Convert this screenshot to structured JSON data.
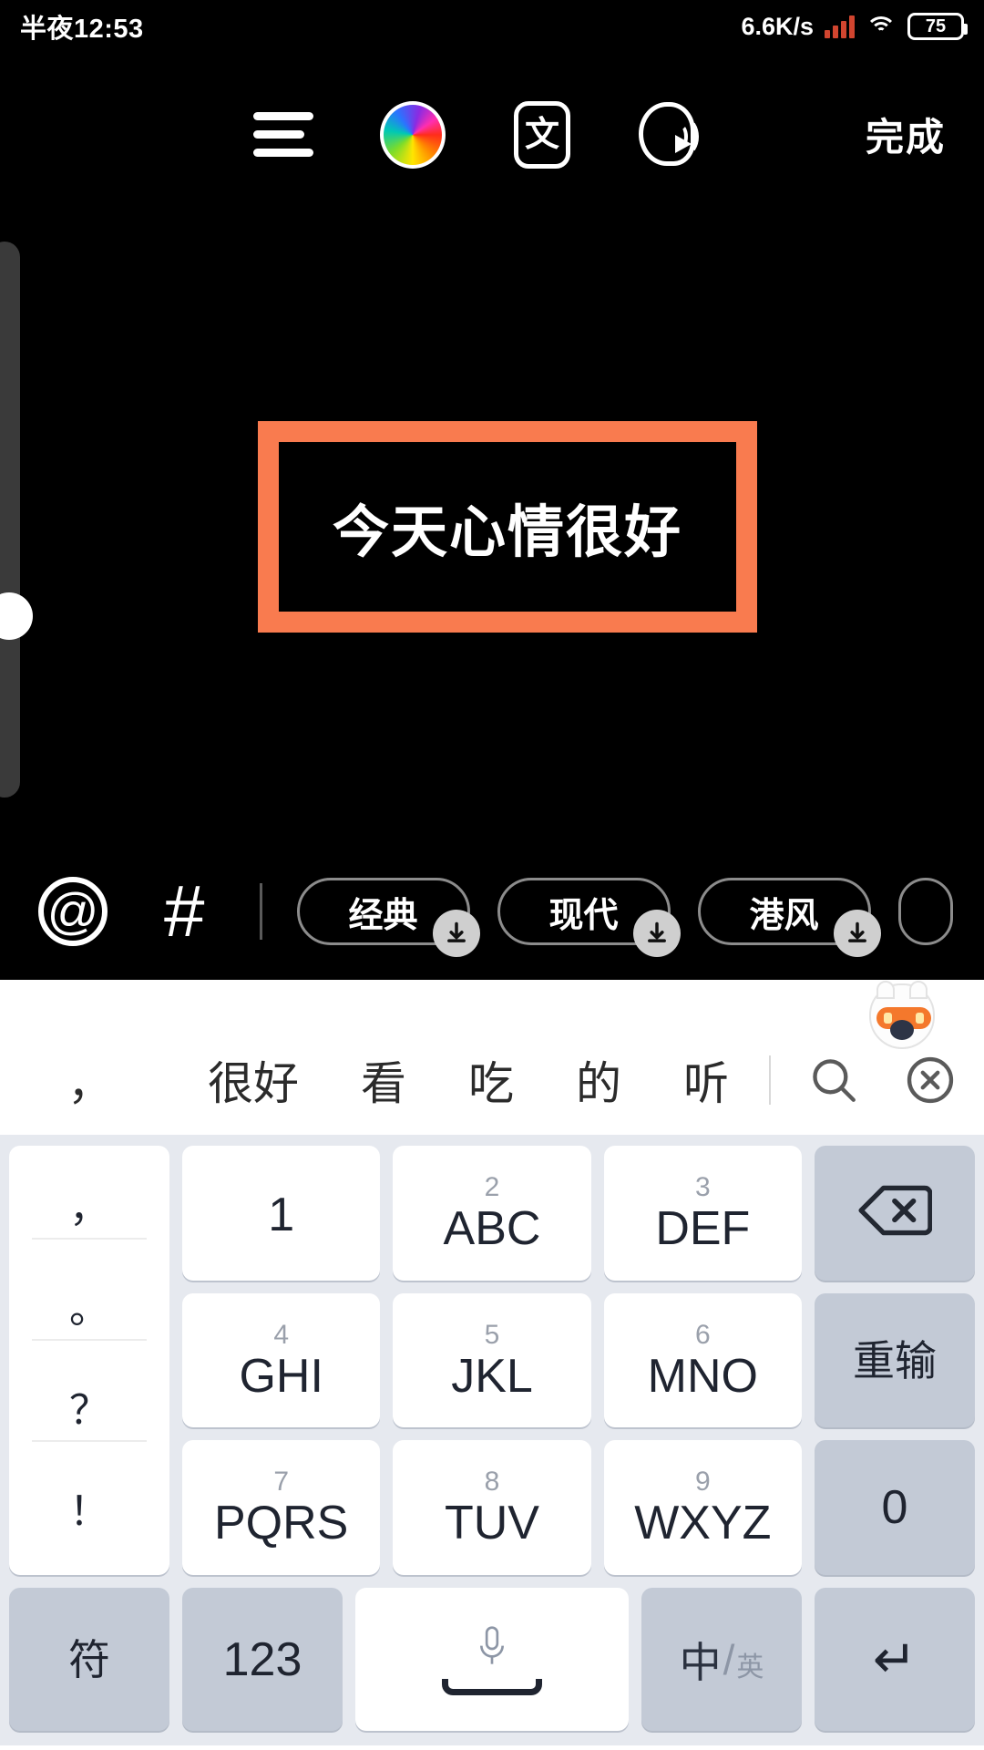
{
  "status_bar": {
    "time": "半夜12:53",
    "net_speed": "6.6K/s",
    "battery_level": "75",
    "signal_icon": "cellular-signal-icon",
    "wifi_icon": "wifi-icon",
    "battery_icon": "battery-icon"
  },
  "toolbar": {
    "menu_icon": "text-align-icon",
    "color_icon": "color-wheel-icon",
    "language_icon": "font-style-icon",
    "language_glyph": "文",
    "voice_icon": "speech-read-icon",
    "done_label": "完成"
  },
  "canvas": {
    "text_content": "今天心情很好",
    "border_color": "#f97b4f",
    "background_color": "#000000",
    "text_color": "#ffffff"
  },
  "style_bar": {
    "mention_icon": "at-mention-icon",
    "mention_glyph": "@",
    "hashtag_icon": "hashtag-icon",
    "hashtag_glyph": "#",
    "chips": [
      {
        "label": "经典",
        "download_icon": "download-arrow-icon"
      },
      {
        "label": "现代",
        "download_icon": "download-arrow-icon"
      },
      {
        "label": "港风",
        "download_icon": "download-arrow-icon"
      }
    ]
  },
  "keyboard": {
    "mascot_icon": "keyboard-mascot-icon",
    "candidates": [
      "，",
      "很好",
      "看",
      "吃",
      "的",
      "听"
    ],
    "search_icon": "search-icon",
    "clear_icon": "close-circle-icon",
    "punct_keys": [
      "，",
      "。",
      "？",
      "！"
    ],
    "rows": [
      [
        {
          "sup": "",
          "main": "1",
          "style": "white"
        },
        {
          "sup": "2",
          "main": "ABC",
          "style": "white"
        },
        {
          "sup": "3",
          "main": "DEF",
          "style": "white"
        },
        {
          "sup": "",
          "main": "",
          "style": "grey",
          "icon": "backspace-icon"
        }
      ],
      [
        {
          "sup": "4",
          "main": "GHI",
          "style": "white"
        },
        {
          "sup": "5",
          "main": "JKL",
          "style": "white"
        },
        {
          "sup": "6",
          "main": "MNO",
          "style": "white"
        },
        {
          "sup": "",
          "main": "重输",
          "style": "grey"
        }
      ],
      [
        {
          "sup": "7",
          "main": "PQRS",
          "style": "white"
        },
        {
          "sup": "8",
          "main": "TUV",
          "style": "white"
        },
        {
          "sup": "9",
          "main": "WXYZ",
          "style": "white"
        },
        {
          "sup": "",
          "main": "0",
          "style": "grey"
        }
      ]
    ],
    "bottom_row": {
      "symbol_label": "符",
      "numeric_label": "123",
      "space_icon": "microphone-space-icon",
      "lang_primary": "中",
      "lang_secondary": "英",
      "enter_icon": "enter-return-icon",
      "enter_glyph": "↵"
    }
  }
}
